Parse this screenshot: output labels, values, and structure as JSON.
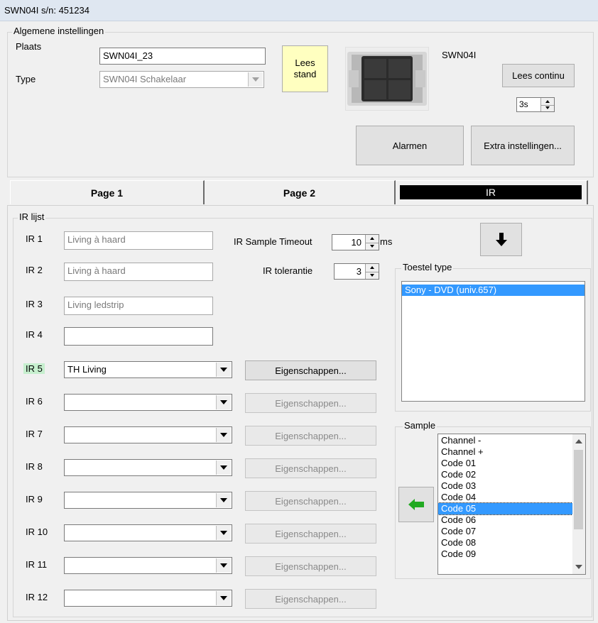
{
  "window": {
    "title": "SWN04I s/n: 451234"
  },
  "general": {
    "legend": "Algemene instellingen",
    "place_label": "Plaats",
    "place_value": "SWN04I_23",
    "type_label": "Type",
    "type_value": "SWN04I Schakelaar",
    "read_state_line1": "Lees",
    "read_state_line2": "stand",
    "device_name": "SWN04I",
    "read_continuous": "Lees continu",
    "interval_value": "3s",
    "alarms": "Alarmen",
    "extra_settings": "Extra instellingen..."
  },
  "tabs": [
    {
      "label": "Page 1"
    },
    {
      "label": "Page 2"
    },
    {
      "label": "IR"
    }
  ],
  "ir": {
    "legend": "IR lijst",
    "sample_timeout_label": "IR Sample Timeout",
    "sample_timeout_value": "10",
    "sample_timeout_unit": "ms",
    "tolerance_label": "IR tolerantie",
    "tolerance_value": "3",
    "properties_label": "Eigenschappen...",
    "rows": [
      {
        "label": "IR 1",
        "value": "Living à haard"
      },
      {
        "label": "IR 2",
        "value": "Living à haard"
      },
      {
        "label": "IR 3",
        "value": "Living ledstrip"
      },
      {
        "label": "IR 4",
        "value": ""
      },
      {
        "label": "IR 5",
        "value": "TH Living"
      },
      {
        "label": "IR 6",
        "value": ""
      },
      {
        "label": "IR 7",
        "value": ""
      },
      {
        "label": "IR 8",
        "value": ""
      },
      {
        "label": "IR 9",
        "value": ""
      },
      {
        "label": "IR 10",
        "value": ""
      },
      {
        "label": "IR 11",
        "value": ""
      },
      {
        "label": "IR 12",
        "value": ""
      }
    ]
  },
  "device_type": {
    "legend": "Toestel type",
    "items": [
      "Sony - DVD (univ.657)"
    ],
    "selected": "Sony - DVD (univ.657)"
  },
  "sample": {
    "legend": "Sample",
    "items": [
      "Channel -",
      "Channel +",
      "Code 01",
      "Code 02",
      "Code 03",
      "Code 04",
      "Code 05",
      "Code 06",
      "Code 07",
      "Code 08",
      "Code 09"
    ],
    "selected": "Code 05"
  },
  "icons": {
    "download": "down-arrow-icon",
    "insert": "left-arrow-icon",
    "insert_color": "#22aa22",
    "selection_color": "#3399ff",
    "active_label_bg": "#c6efce",
    "read_state_bg": "#ffffc0"
  }
}
